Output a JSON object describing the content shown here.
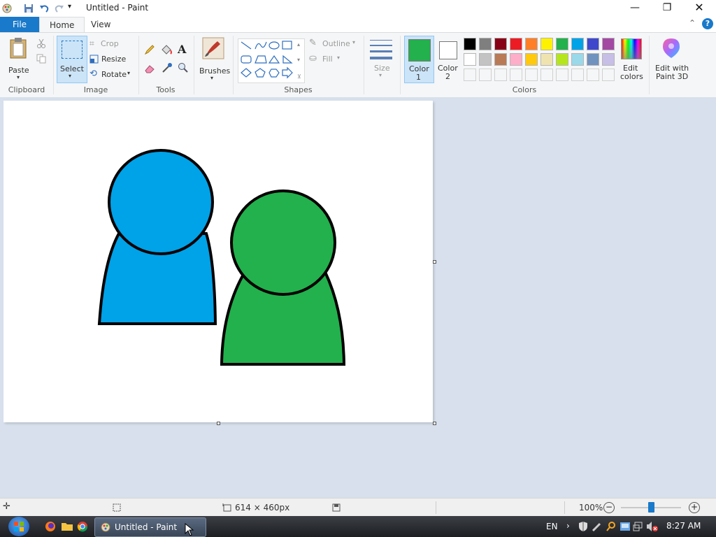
{
  "window": {
    "title": "Untitled - Paint"
  },
  "tabs": [
    {
      "label": "File"
    },
    {
      "label": "Home"
    },
    {
      "label": "View"
    }
  ],
  "ribbon": {
    "clipboard": {
      "label": "Clipboard",
      "paste": "Paste"
    },
    "image": {
      "label": "Image",
      "select": "Select",
      "crop": "Crop",
      "resize": "Resize",
      "rotate": "Rotate"
    },
    "tools": {
      "label": "Tools"
    },
    "brushes": {
      "label": "Brushes"
    },
    "shapes": {
      "label": "Shapes",
      "outline": "Outline",
      "fill": "Fill"
    },
    "size": {
      "label": "Size"
    },
    "colors": {
      "label": "Colors",
      "color1": "Color",
      "color1_num": "1",
      "color2": "Color",
      "color2_num": "2",
      "color1_value": "#22b14c",
      "color2_value": "#ffffff",
      "edit_colors_1": "Edit",
      "edit_colors_2": "colors",
      "palette_row1": [
        "#000000",
        "#7f7f7f",
        "#880015",
        "#ed1c24",
        "#ff7f27",
        "#fff200",
        "#22b14c",
        "#00a2e8",
        "#3f48cc",
        "#a349a4"
      ],
      "palette_row2": [
        "#ffffff",
        "#c3c3c3",
        "#b97a57",
        "#ffaec9",
        "#ffc90e",
        "#efe4b0",
        "#b5e61d",
        "#99d9ea",
        "#7092be",
        "#c8bfe7"
      ]
    },
    "paint3d": {
      "line1": "Edit with",
      "line2": "Paint 3D"
    }
  },
  "canvas": {
    "shape_colors": {
      "blue": "#00a2e8",
      "green": "#22b14c",
      "outline": "#000000"
    }
  },
  "status": {
    "dimensions": "614 × 460px",
    "zoom": "100%"
  },
  "taskbar": {
    "app": "Untitled - Paint",
    "lang": "EN",
    "time": "8:27 AM"
  }
}
